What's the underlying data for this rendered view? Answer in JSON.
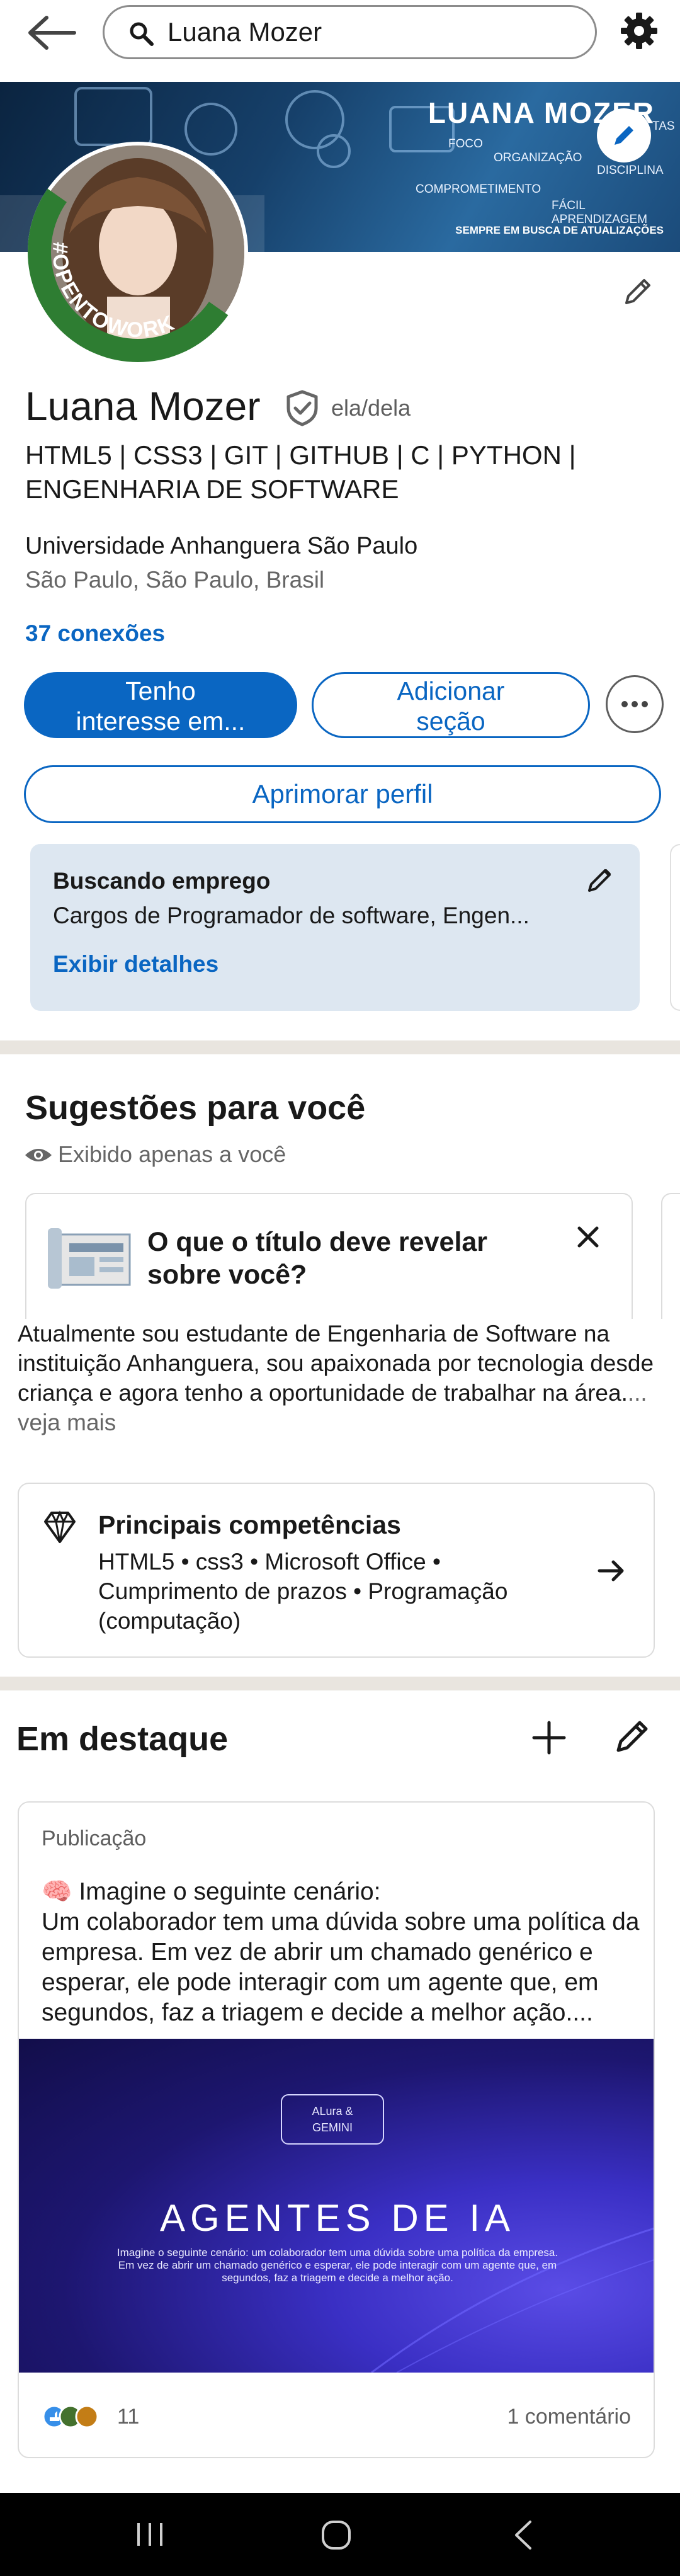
{
  "search": {
    "value": "Luana Mozer"
  },
  "banner": {
    "name": "LUANA MOZER",
    "words": [
      "FOCO",
      "ORGANIZAÇÃO",
      "DISCIPLINA",
      "COMPROMETIMENTO",
      "FÁCIL APRENDIZAGEM",
      "TAS"
    ],
    "tagline": "SEMPRE EM BUSCA DE ATUALIZAÇÕES"
  },
  "profile": {
    "opentowork_label": "#OPENTOWORK",
    "name": "Luana Mozer",
    "pronouns": "ela/dela",
    "headline": "HTML5 | CSS3 | GIT | GITHUB | C | PYTHON | ENGENHARIA DE SOFTWARE",
    "education": "Universidade Anhanguera São Paulo",
    "location": "São Paulo, São Paulo, Brasil",
    "connections": "37 conexões"
  },
  "actions": {
    "primary_line1": "Tenho",
    "primary_line2": "interesse em...",
    "secondary_line1": "Adicionar",
    "secondary_line2": "seção",
    "wide": "Aprimorar perfil"
  },
  "open_to_work": {
    "title": "Buscando emprego",
    "description": "Cargos de Programador de software, Engen...",
    "link": "Exibir detalhes"
  },
  "suggestions": {
    "title": "Sugestões para você",
    "subtitle": "Exibido apenas a você",
    "card_text": "O que o título deve revelar sobre você?"
  },
  "about": {
    "text": "Atualmente sou estudante de Engenharia de Software na instituição Anhanguera, sou apaixonada por tecnologia desde criança e agora tenho a oportunidade de trabalhar na área.",
    "more": "... veja mais"
  },
  "skills": {
    "title": "Principais competências",
    "list": "HTML5 • css3 • Microsoft Office • Cumprimento de prazos • Programação (computação)"
  },
  "featured": {
    "title": "Em destaque",
    "post": {
      "label": "Publicação",
      "text": "🧠 Imagine o seguinte cenário:\n Um colaborador tem uma dúvida sobre uma política da empresa. Em vez de abrir um chamado genérico e esperar, ele pode interagir com um agente que, em segundos, faz a triagem e decide a melhor ação....",
      "badge_line1": "ALura &",
      "badge_line2": "GEMINI",
      "image_title": "AGENTES DE IA",
      "image_text": "Imagine o seguinte cenário: um colaborador tem uma dúvida sobre uma política da empresa. Em vez de abrir um chamado genérico e esperar, ele pode interagir com um agente que, em segundos, faz a triagem e decide a melhor ação.",
      "reactions": "11",
      "comments": "1 comentário"
    }
  },
  "colors": {
    "accent": "#0a66c2",
    "opentowork_green": "#2e7d32",
    "card_blue": "#dde7f1",
    "divider": "#e9e5df"
  }
}
